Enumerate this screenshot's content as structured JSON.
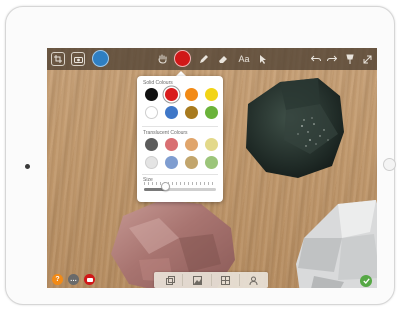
{
  "popover": {
    "solid_label": "Solid Colours",
    "translucent_label": "Translucent Colours",
    "size_label": "Size",
    "solid_colors": [
      "#111111",
      "#d91c1c",
      "#f28a16",
      "#f2d416",
      "#ffffff",
      "#3f77c8",
      "#a87a1e",
      "#6bb33a"
    ],
    "translucent_colors": [
      "#5c5c5c",
      "#d96f72",
      "#e0a56b",
      "#e3d98a",
      "#e4e4e4",
      "#7f9dd0",
      "#c2a56c",
      "#9cc57a"
    ],
    "selected_index": 1,
    "size_level": 0.3
  },
  "toolbar": {
    "text_tool_label": "Aa",
    "brush_color": "#2f7fc2",
    "current_color": "#d01818"
  },
  "icons": {
    "toolbar": [
      "crop-icon",
      "camera-icon",
      "brush-icon",
      "hand-icon",
      "color-icon",
      "pen-icon",
      "eraser-icon",
      "text-icon",
      "pointer-icon",
      "undo-icon",
      "redo-icon",
      "pin-icon",
      "expand-icon"
    ],
    "bottom_left": [
      "help-icon",
      "chat-icon",
      "record-icon"
    ],
    "bottom_bar": [
      "layers-icon",
      "image-icon",
      "grid-icon",
      "user-icon"
    ],
    "confirm": "confirm-icon"
  },
  "colors": {
    "help": "#f28a16",
    "chat": "#6a6a6a",
    "record": "#d01818",
    "confirm": "#56a845"
  },
  "bottom_left_labels": {
    "help": "?",
    "chat": "…"
  }
}
